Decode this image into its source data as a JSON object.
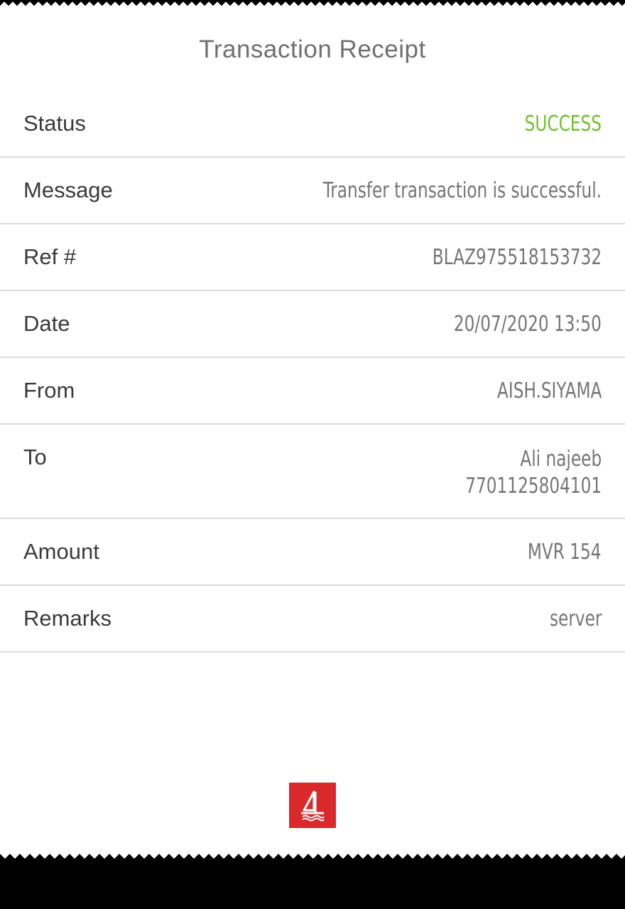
{
  "receipt": {
    "title": "Transaction Receipt",
    "rows": [
      {
        "label": "Status",
        "value": "SUCCESS"
      },
      {
        "label": "Message",
        "value": "Transfer transaction is successful."
      },
      {
        "label": "Ref #",
        "value": "BLAZ975518153732"
      },
      {
        "label": "Date",
        "value": "20/07/2020 13:50"
      },
      {
        "label": "From",
        "value": "AISH.SIYAMA"
      },
      {
        "label": "To",
        "value_line1": "Ali najeeb",
        "value_line2": "7701125804101"
      },
      {
        "label": "Amount",
        "value": "MVR 154"
      },
      {
        "label": "Remarks",
        "value": "server"
      }
    ]
  },
  "colors": {
    "success": "#72c02c",
    "brand": "#d9292b"
  },
  "icons": {
    "logo": "bank-logo-sailboat-icon"
  }
}
